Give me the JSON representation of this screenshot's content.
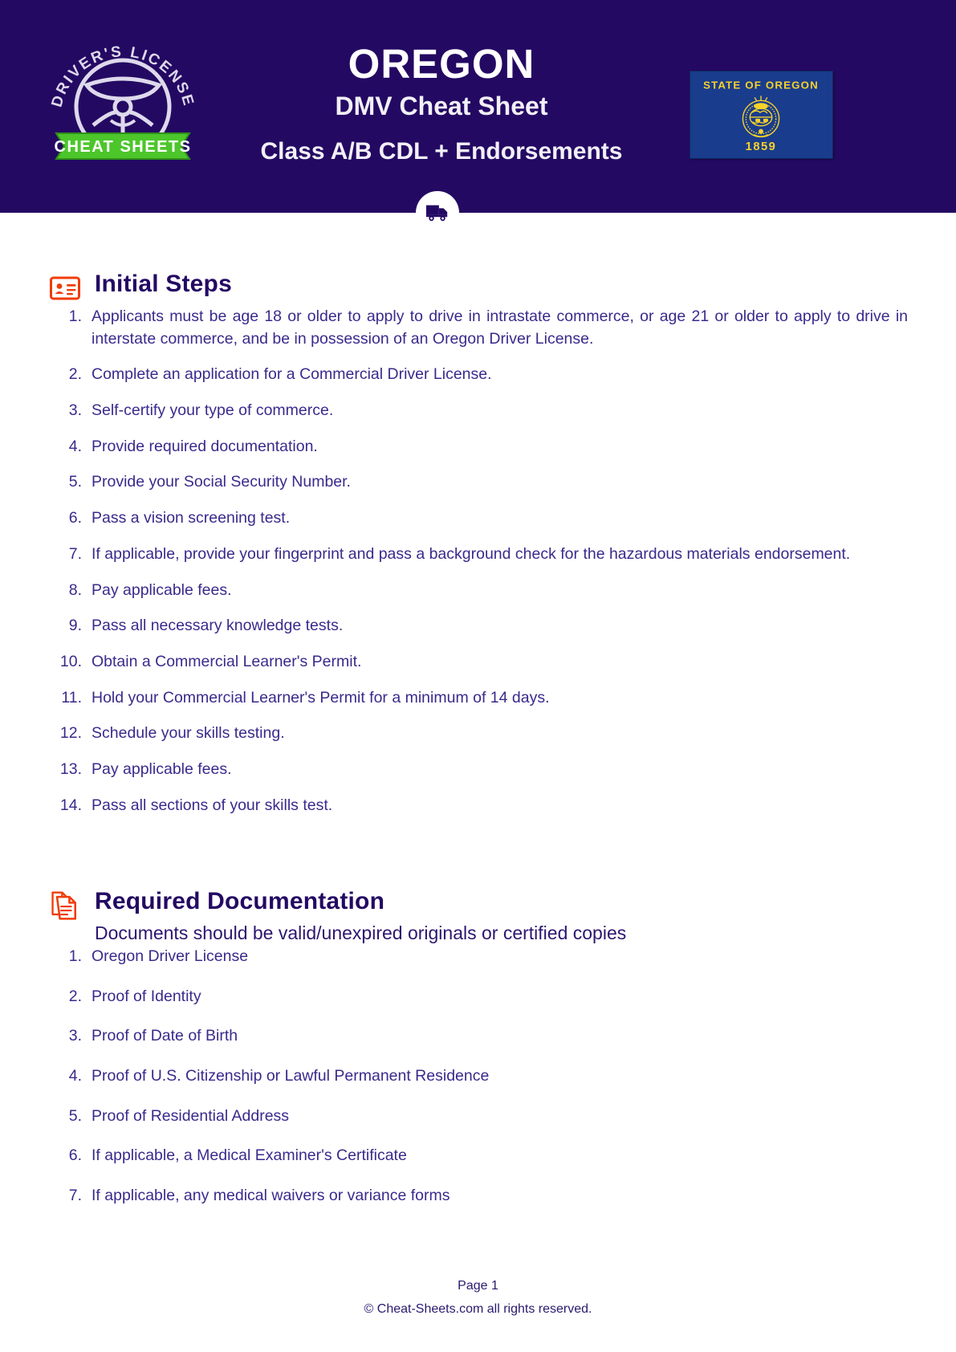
{
  "header": {
    "state": "OREGON",
    "subtitle": "DMV Cheat Sheet",
    "class_line": "Class A/B CDL + Endorsements",
    "logo": {
      "arc_text": "DRIVER'S LICENSE",
      "banner_text": "CHEAT SHEETS"
    },
    "flag": {
      "top_text": "STATE OF OREGON",
      "year": "1859"
    },
    "colors": {
      "header_bg": "#240963",
      "banner_green": "#4cc62b",
      "flag_blue": "#1a3c8c",
      "flag_gold": "#f6d22a"
    }
  },
  "sections": [
    {
      "id": "initial-steps",
      "icon": "id-card-icon",
      "title": "Initial Steps",
      "subtitle": "",
      "items": [
        "Applicants must be age 18 or older to apply to drive in intrastate commerce, or age 21 or older to apply to drive in interstate commerce, and be in possession of an Oregon Driver License.",
        "Complete an application for a Commercial Driver License.",
        "Self-certify your type of commerce.",
        "Provide required documentation.",
        "Provide your Social Security Number.",
        "Pass a vision screening test.",
        "If applicable, provide your fingerprint and pass a background check for the hazardous materials endorsement.",
        "Pay applicable fees.",
        "Pass all necessary knowledge tests.",
        "Obtain a Commercial Learner's Permit.",
        "Hold your Commercial Learner's Permit for a minimum of 14 days.",
        "Schedule your skills testing.",
        "Pay applicable fees.",
        "Pass all sections of your skills test."
      ]
    },
    {
      "id": "required-documentation",
      "icon": "document-icon",
      "title": "Required Documentation",
      "subtitle": "Documents should be valid/unexpired originals or certified copies",
      "items": [
        "Oregon Driver License",
        "Proof of Identity",
        "Proof of Date of Birth",
        "Proof of U.S. Citizenship or Lawful Permanent Residence",
        "Proof of Residential Address",
        "If applicable, a Medical Examiner's Certificate",
        "If applicable, any medical waivers or variance forms"
      ]
    }
  ],
  "footer": {
    "page_label": "Page 1",
    "copyright": "©  Cheat-Sheets.com all rights reserved."
  },
  "theme": {
    "purple": "#240963",
    "body_text": "#3a2a8c",
    "accent_orange": "#f03c0a"
  }
}
